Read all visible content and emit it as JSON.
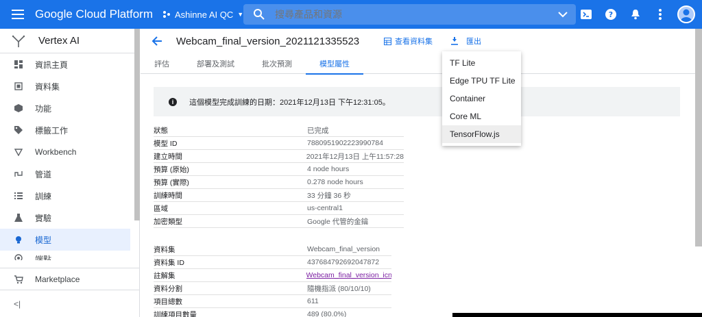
{
  "topbar": {
    "brand": "Google Cloud Platform",
    "project": "Ashinne AI QC",
    "search_placeholder": "搜尋產品和資源",
    "accent": "#1a73e8"
  },
  "sidebar": {
    "title": "Vertex AI",
    "items": [
      {
        "label": "資訊主頁",
        "icon": "dashboard-icon"
      },
      {
        "label": "資料集",
        "icon": "dataset-icon"
      },
      {
        "label": "功能",
        "icon": "features-icon"
      },
      {
        "label": "標籤工作",
        "icon": "label-tag-icon"
      },
      {
        "label": "Workbench",
        "icon": "workbench-icon"
      },
      {
        "label": "管道",
        "icon": "pipelines-icon"
      },
      {
        "label": "訓練",
        "icon": "training-icon"
      },
      {
        "label": "實驗",
        "icon": "experiments-icon"
      },
      {
        "label": "模型",
        "icon": "lightbulb-icon"
      },
      {
        "label": "端點",
        "icon": "endpoints-icon"
      }
    ],
    "marketplace": "Marketplace",
    "collapse": "<|"
  },
  "header": {
    "model_name": "Webcam_final_version_2021121335523",
    "view_dataset": "查看資料集",
    "export": "匯出"
  },
  "tabs": [
    "評估",
    "部署及測試",
    "批次預測",
    "模型屬性"
  ],
  "notice": "這個模型完成訓練的日期：2021年12月13日 下午12:31:05。",
  "model_props": [
    {
      "k": "狀態",
      "v": "已完成"
    },
    {
      "k": "模型 ID",
      "v": "7880951902223990784"
    },
    {
      "k": "建立時間",
      "v": "2021年12月13日 上午11:57:28"
    },
    {
      "k": "預算 (原始)",
      "v": "4 node hours"
    },
    {
      "k": "預算 (實際)",
      "v": "0.278 node hours"
    },
    {
      "k": "訓練時間",
      "v": "33 分鐘 36 秒"
    },
    {
      "k": "區域",
      "v": "us-central1"
    },
    {
      "k": "加密類型",
      "v": "Google 代管的金鑰"
    }
  ],
  "dataset_props": [
    {
      "k": "資料集",
      "v": "Webcam_final_version"
    },
    {
      "k": "資料集 ID",
      "v": "437684792692047872"
    },
    {
      "k": "註解集",
      "v": "Webcam_final_version_icn"
    },
    {
      "k": "資料分割",
      "v": "隨機指派 (80/10/10)"
    },
    {
      "k": "項目總數",
      "v": "611"
    },
    {
      "k": "訓練項目數量",
      "v": "489 (80.0%)"
    }
  ],
  "export_menu": [
    "TF Lite",
    "Edge TPU TF Lite",
    "Container",
    "Core ML",
    "TensorFlow.js"
  ]
}
